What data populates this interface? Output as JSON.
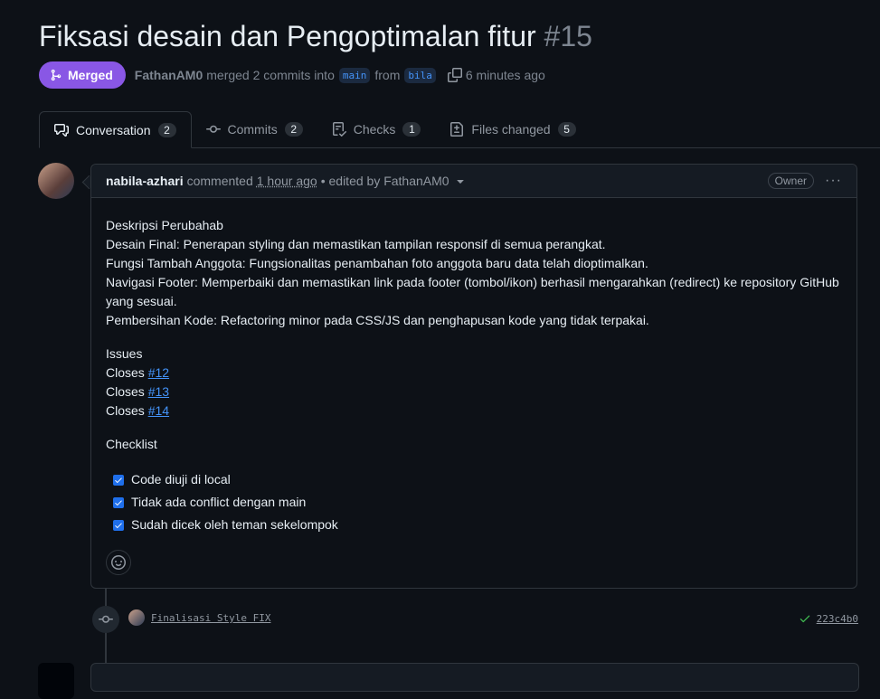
{
  "pr": {
    "title": "Fiksasi desain dan Pengoptimalan fitur",
    "number": "#15",
    "status": "Merged",
    "author": "FathanAM0",
    "merge_text": "merged 2 commits into",
    "base_branch": "main",
    "from_text": "from",
    "head_branch": "bila",
    "time": "6 minutes ago"
  },
  "tabs": [
    {
      "label": "Conversation",
      "count": "2",
      "icon": "comment-icon"
    },
    {
      "label": "Commits",
      "count": "2",
      "icon": "commit-icon"
    },
    {
      "label": "Checks",
      "count": "1",
      "icon": "checklist-icon"
    },
    {
      "label": "Files changed",
      "count": "5",
      "icon": "file-diff-icon"
    }
  ],
  "comment": {
    "user": "nabila-azhari",
    "action": "commented",
    "time": "1 hour ago",
    "edited": "• edited by FathanAM0",
    "role": "Owner",
    "lines": [
      "Deskripsi Perubahab",
      "Desain Final: Penerapan styling dan memastikan tampilan responsif di semua perangkat.",
      "Fungsi Tambah Anggota: Fungsionalitas penambahan foto anggota baru data telah dioptimalkan.",
      "Navigasi Footer: Memperbaiki dan memastikan link pada footer (tombol/ikon) berhasil mengarahkan (redirect) ke repository GitHub yang sesuai.",
      "Pembersihan Kode: Refactoring minor pada CSS/JS dan penghapusan kode yang tidak terpakai."
    ],
    "issues_heading": "Issues",
    "closes_label": "Closes",
    "issues": [
      "#12",
      "#13",
      "#14"
    ],
    "checklist_heading": "Checklist",
    "checklist": [
      {
        "label": "Code diuji di local",
        "checked": true
      },
      {
        "label": "Tidak ada conflict dengan main",
        "checked": true
      },
      {
        "label": "Sudah dicek oleh teman sekelompok",
        "checked": true
      }
    ]
  },
  "commit": {
    "message": "Finalisasi Style FIX",
    "sha": "223c4b0",
    "status": "success"
  },
  "colors": {
    "merged": "#8957e5",
    "link": "#4493f8",
    "success": "#3fb950",
    "background": "#0d1117"
  }
}
